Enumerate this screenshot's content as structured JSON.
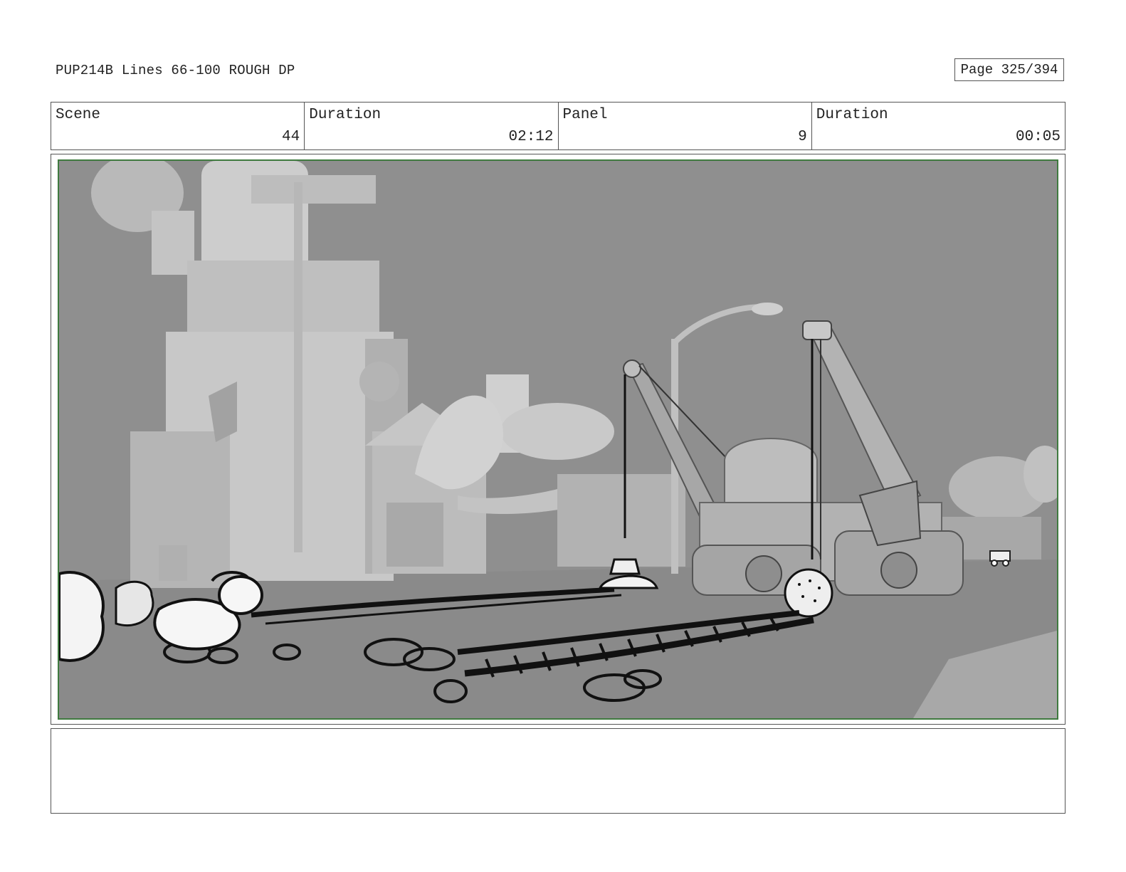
{
  "header": {
    "doc_title": "PUP214B Lines 66-100 ROUGH DP",
    "page_label": "Page 325/394"
  },
  "info": {
    "scene_label": "Scene",
    "scene_value": "44",
    "scene_duration_label": "Duration",
    "scene_duration_value": "02:12",
    "panel_label": "Panel",
    "panel_value": "9",
    "panel_duration_label": "Duration",
    "panel_duration_value": "00:05"
  },
  "colors": {
    "frame_border": "#555555",
    "panel_border": "#3f7a3f",
    "sky": "#8e8e8e",
    "ground": "#8a8a8a"
  },
  "notes": {
    "text": ""
  }
}
